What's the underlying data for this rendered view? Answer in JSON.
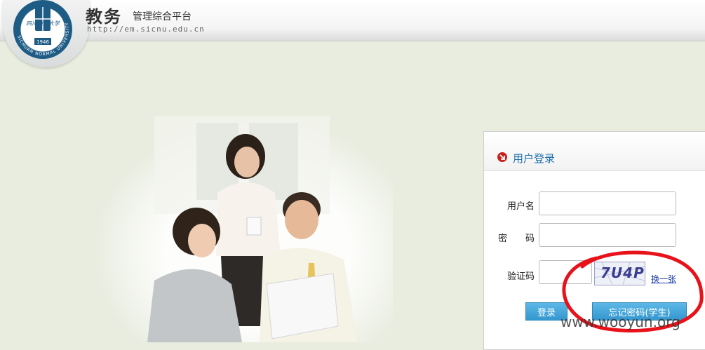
{
  "header": {
    "title_main": "教务",
    "title_sub": "管理综合平台",
    "url": "http://em.sicnu.edu.cn",
    "logo": {
      "name_text": "四川师范大学",
      "year": "1946",
      "ring_text": "SICHUAN NORMAL UNIVERSITY"
    }
  },
  "login": {
    "title": "用户登录",
    "username_label": "用户名",
    "username_value": "",
    "password_label": "密　　码",
    "password_value": "",
    "captcha_label": "验证码",
    "captcha_value": "",
    "captcha_image_text": "7U4P",
    "refresh_label": "换一张",
    "login_button": "登录",
    "forgot_button": "忘记密码(学生)"
  },
  "watermark": "www.wooyun.org",
  "colors": {
    "page_bg": "#e9ede0",
    "link_blue": "#1d3fa8",
    "title_blue": "#1f6fa8",
    "button_blue": "#3497cf",
    "annotation_red": "#e8121a"
  }
}
